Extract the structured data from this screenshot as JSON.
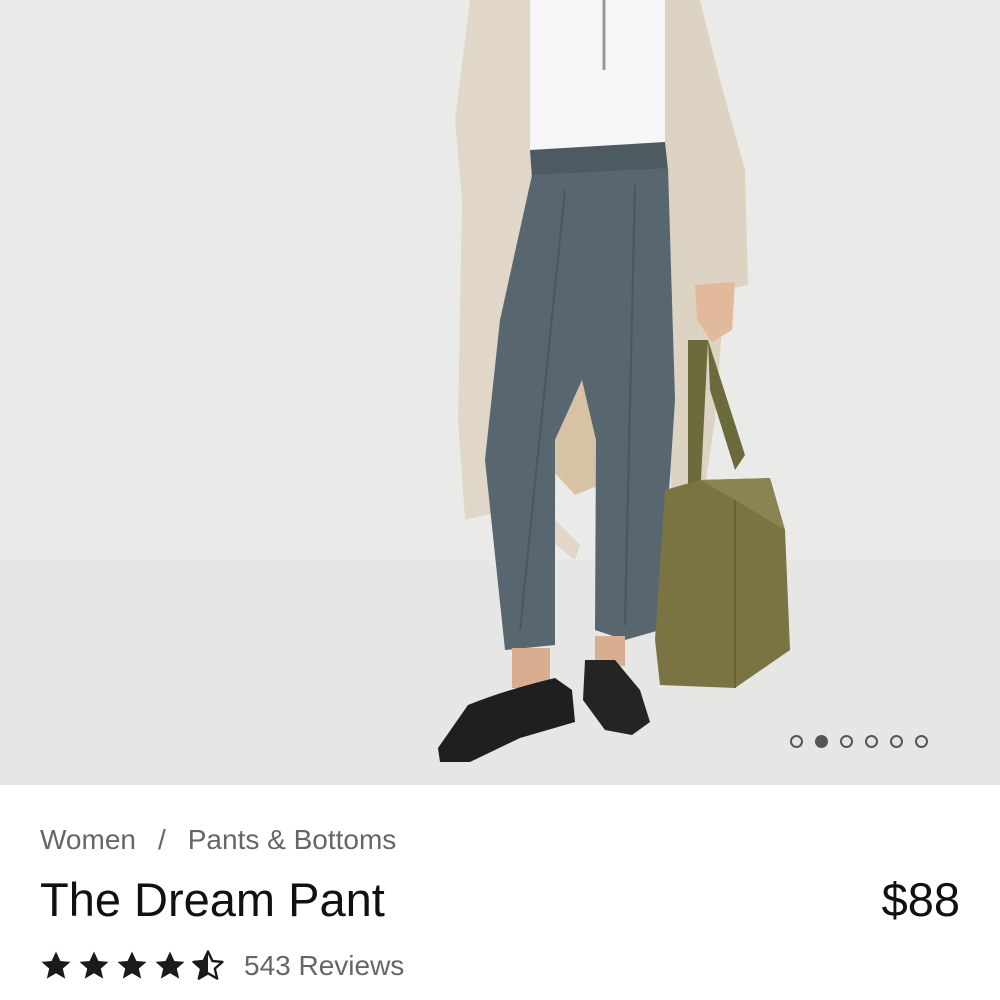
{
  "product_image": {
    "carousel": {
      "total_slides": 6,
      "active_index": 1
    }
  },
  "breadcrumb": {
    "items": [
      "Women",
      "Pants & Bottoms"
    ],
    "separator": "/"
  },
  "product": {
    "title": "The Dream Pant",
    "price": "$88"
  },
  "rating": {
    "stars": 4.5,
    "max": 5,
    "reviews_label": "543 Reviews"
  },
  "colors": {
    "text_primary": "#111111",
    "text_secondary": "#666666",
    "image_background": "#eaebe9"
  }
}
